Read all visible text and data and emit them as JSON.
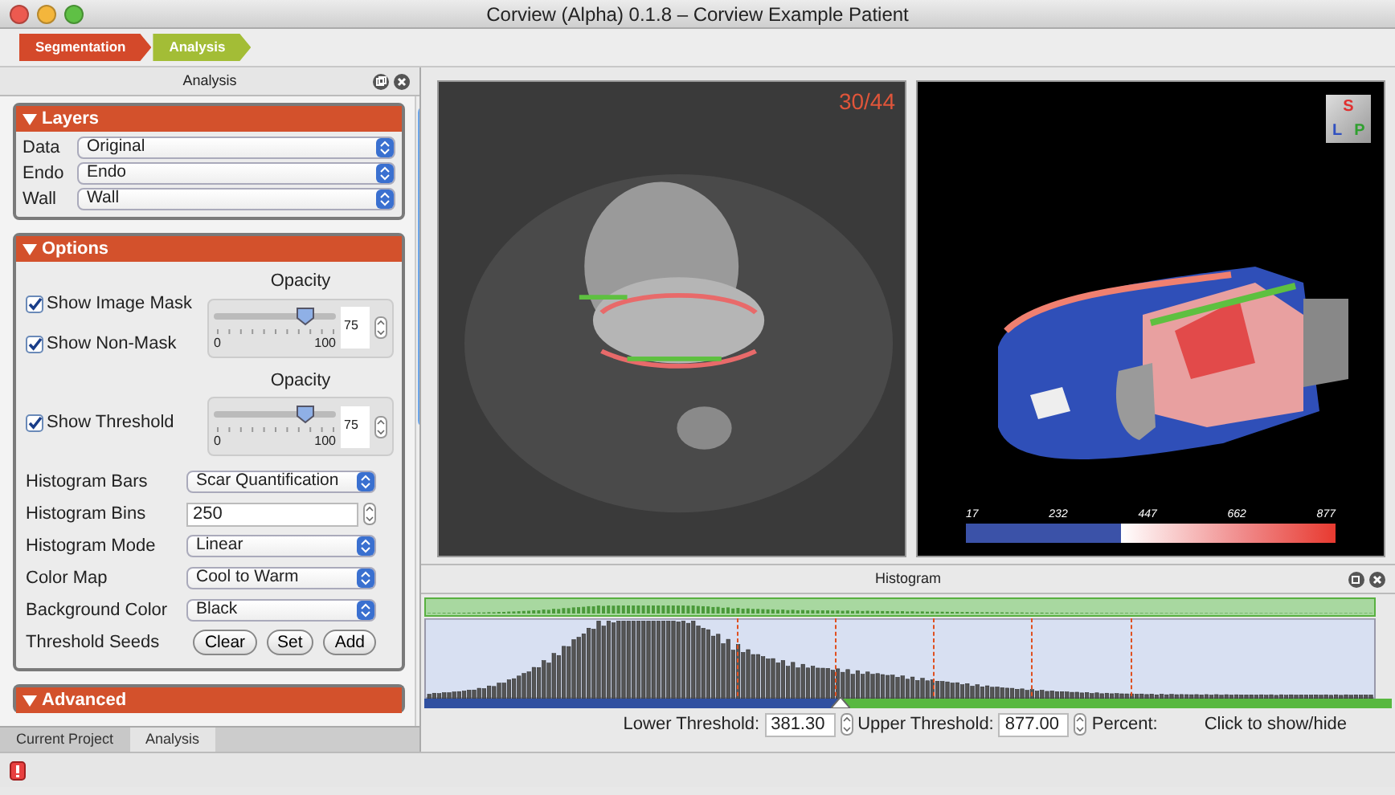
{
  "window": {
    "title": "Corview (Alpha) 0.1.8 – Corview Example Patient"
  },
  "workflow_steps": [
    {
      "label": "Segmentation",
      "color": "#d4492a"
    },
    {
      "label": "Analysis",
      "color": "#a3bd36"
    }
  ],
  "analysis_panel": {
    "title": "Analysis",
    "layers": {
      "title": "Layers",
      "expanded": true,
      "rows": [
        {
          "label": "Data",
          "value": "Original"
        },
        {
          "label": "Endo",
          "value": "Endo"
        },
        {
          "label": "Wall",
          "value": "Wall"
        }
      ]
    },
    "options": {
      "title": "Options",
      "expanded": true,
      "opacity_groups": [
        {
          "heading": "Opacity",
          "checkboxes": [
            {
              "label": "Show Image Mask",
              "checked": true
            },
            {
              "label": "Show Non-Mask",
              "checked": true
            }
          ],
          "slider": {
            "level": 0.75,
            "min_label": "0",
            "max_label": "100"
          },
          "value": "75"
        },
        {
          "heading": "Opacity",
          "checkboxes": [
            {
              "label": "Show Threshold",
              "checked": true
            }
          ],
          "slider": {
            "level": 0.75,
            "min_label": "0",
            "max_label": "100"
          },
          "value": "75"
        }
      ],
      "fields": [
        {
          "kind": "select",
          "label": "Histogram Bars",
          "value": "Scar Quantification"
        },
        {
          "kind": "spin",
          "label": "Histogram Bins",
          "value": "250"
        },
        {
          "kind": "select",
          "label": "Histogram Mode",
          "value": "Linear"
        },
        {
          "kind": "select",
          "label": "Color Map",
          "value": "Cool to Warm"
        },
        {
          "kind": "select",
          "label": "Background Color",
          "value": "Black"
        },
        {
          "kind": "buttons",
          "label": "Threshold Seeds",
          "buttons": [
            "Clear",
            "Set",
            "Add"
          ]
        }
      ]
    },
    "advanced": {
      "title": "Advanced",
      "expanded": true
    },
    "bottom_tabs": [
      {
        "label": "Current Project",
        "selected": false
      },
      {
        "label": "Analysis",
        "selected": true
      }
    ]
  },
  "slice_view": {
    "slice_counter": "30/44"
  },
  "volume_view": {
    "orientation_labels": [
      "S",
      "L",
      "P"
    ],
    "colorbar_labels": [
      "17",
      "232",
      "447",
      "662",
      "877"
    ]
  },
  "histogram": {
    "title": "Histogram",
    "threshold_slider": {
      "level": 0.43
    },
    "lower_threshold": {
      "label": "Lower Threshold:",
      "value": "381.30"
    },
    "upper_threshold": {
      "label": "Upper Threshold:",
      "value": "877.00"
    },
    "percent_label": "Percent:",
    "toggle_label": "Click to show/hide"
  }
}
